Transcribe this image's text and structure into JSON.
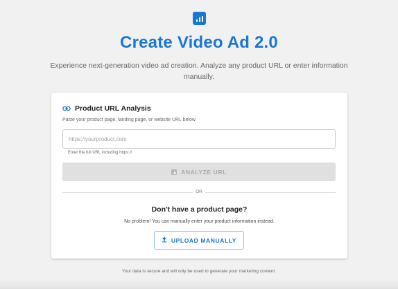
{
  "header": {
    "logo_icon": "bar-chart-icon",
    "title": "Create Video Ad 2.0",
    "subtitle": "Experience next-generation video ad creation. Analyze any product URL or enter information manually."
  },
  "url_section": {
    "icon": "link-icon",
    "title": "Product URL Analysis",
    "helper": "Paste your product page, landing page, or website URL below",
    "input_value": "",
    "input_placeholder": "https://yourproduct.com",
    "input_hint": "Enter the full URL including https://",
    "analyze_icon": "analytics-icon",
    "analyze_label": "ANALYZE URL",
    "analyze_disabled": true
  },
  "divider": {
    "label": "OR"
  },
  "manual_section": {
    "title": "Don't have a product page?",
    "subtitle": "No problem! You can manually enter your product information instead.",
    "upload_icon": "upload-icon",
    "upload_label": "UPLOAD MANUALLY"
  },
  "footer": {
    "text": "Your data is secure and will only be used to generate your marketing content."
  },
  "colors": {
    "accent": "#1976d2",
    "background": "#f1f1f1",
    "card": "#ffffff",
    "disabled_button": "#e0e0e0"
  }
}
